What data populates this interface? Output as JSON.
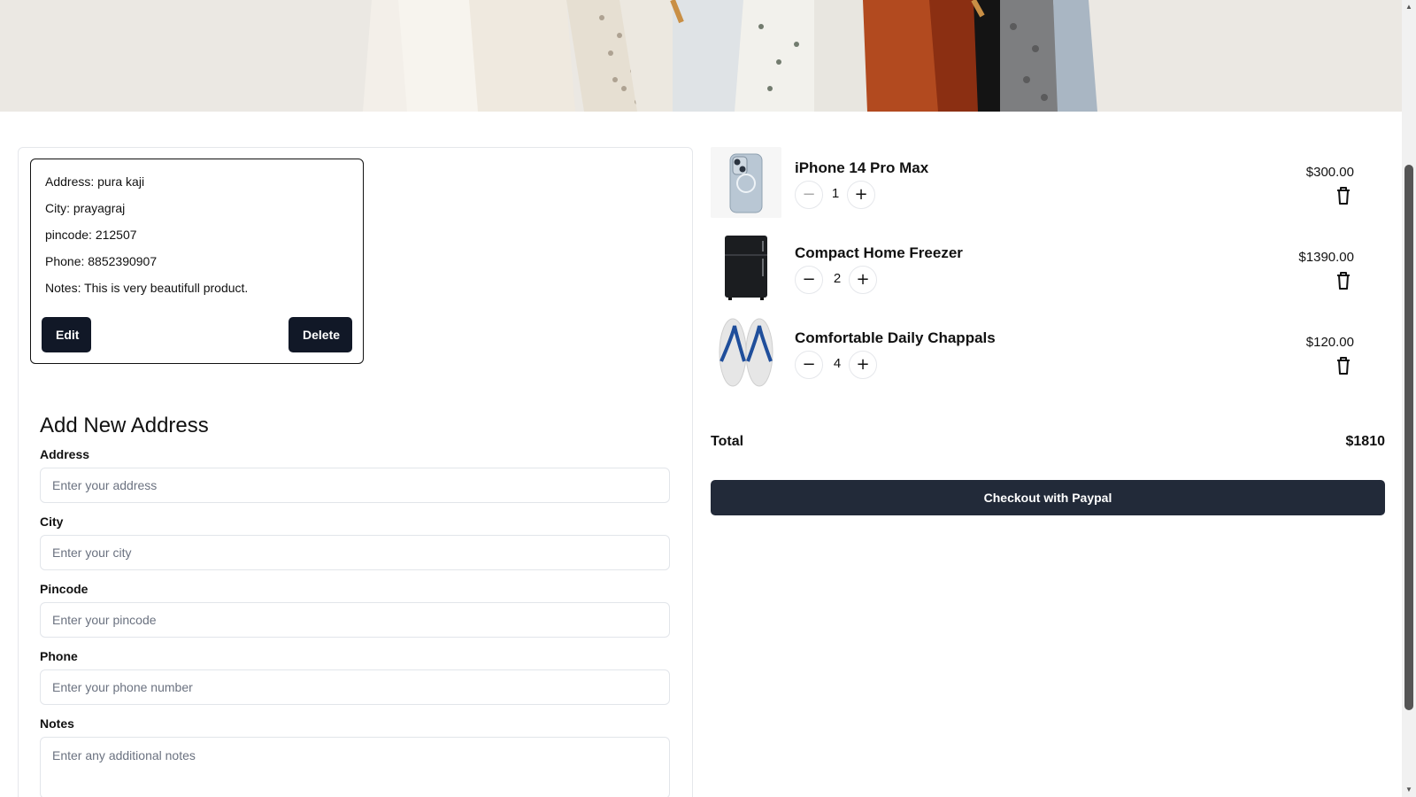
{
  "saved_address": {
    "address": "Address: pura kaji",
    "city": "City: prayagraj",
    "pincode": "pincode: 212507",
    "phone": "Phone: 8852390907",
    "notes": "Notes: This is very beautifull product.",
    "edit_label": "Edit",
    "delete_label": "Delete"
  },
  "form": {
    "title": "Add New Address",
    "address_label": "Address",
    "address_placeholder": "Enter your address",
    "city_label": "City",
    "city_placeholder": "Enter your city",
    "pincode_label": "Pincode",
    "pincode_placeholder": "Enter your pincode",
    "phone_label": "Phone",
    "phone_placeholder": "Enter your phone number",
    "notes_label": "Notes",
    "notes_placeholder": "Enter any additional notes"
  },
  "cart": {
    "items": [
      {
        "name": "iPhone 14 Pro Max",
        "qty": "1",
        "price": "$300.00",
        "icon": "phone-image"
      },
      {
        "name": "Compact Home Freezer",
        "qty": "2",
        "price": "$1390.00",
        "icon": "freezer-image"
      },
      {
        "name": "Comfortable Daily Chappals",
        "qty": "4",
        "price": "$120.00",
        "icon": "chappals-image"
      }
    ],
    "minus_symbol": "−",
    "plus_symbol": "+",
    "total_label": "Total",
    "total_value": "$1810",
    "checkout_label": "Checkout with Paypal"
  },
  "colors": {
    "button_dark": "#111827",
    "checkout_bg": "#222a39"
  }
}
